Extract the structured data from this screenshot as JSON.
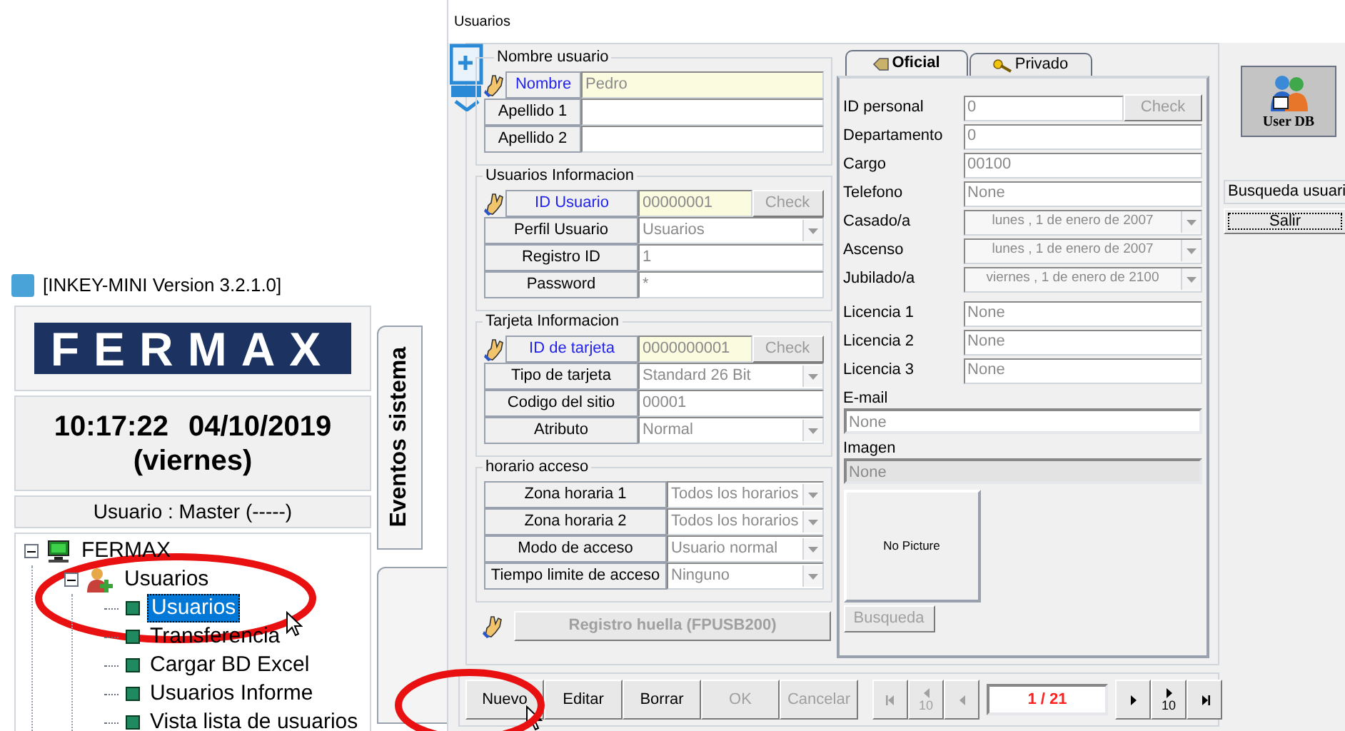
{
  "main_window": {
    "title": "[INKEY-MINI Version 3.2.1.0]",
    "logo": "FERMAX",
    "clock": {
      "time": "10:17:22",
      "date": "04/10/2019",
      "weekday": "(viernes)"
    },
    "user_label": "Usuario : Master (-----)",
    "side_tab": "Eventos sistema",
    "tree": [
      {
        "label": "FERMAX",
        "kind": "computer",
        "expanded": true,
        "selected": false,
        "children": [
          {
            "label": "Usuarios",
            "kind": "users",
            "expanded": true,
            "selected": false,
            "children": [
              {
                "label": "Usuarios",
                "kind": "leaf",
                "selected": true
              },
              {
                "label": "Transferencia",
                "kind": "leaf",
                "selected": false
              },
              {
                "label": "Cargar BD Excel",
                "kind": "leaf",
                "selected": false
              },
              {
                "label": "Usuarios Informe",
                "kind": "leaf",
                "selected": false
              },
              {
                "label": "Vista lista de usuarios",
                "kind": "leaf",
                "selected": false
              }
            ]
          }
        ]
      }
    ]
  },
  "dialog": {
    "title": "Usuarios",
    "groups": [
      {
        "title": "Nombre usuario",
        "rows": [
          {
            "label": "Nombre",
            "kind": "text",
            "value": "Pedro",
            "primary": true
          },
          {
            "label": "Apellido 1",
            "kind": "text",
            "primary": false
          },
          {
            "label": "Apellido 2",
            "kind": "text",
            "primary": false
          }
        ]
      },
      {
        "title": "Usuarios Informacion",
        "rows": [
          {
            "label": "ID Usuario",
            "kind": "text",
            "value": "00000001",
            "primary": true,
            "button": "Check"
          },
          {
            "label": "Perfil Usuario",
            "kind": "select",
            "value": "Usuarios",
            "primary": false
          },
          {
            "label": "Registro ID",
            "kind": "text",
            "value": "1",
            "primary": false
          },
          {
            "label": "Password",
            "kind": "text",
            "value": "*",
            "primary": false
          }
        ]
      },
      {
        "title": "Tarjeta Informacion",
        "rows": [
          {
            "label": "ID de tarjeta",
            "kind": "text",
            "value": "0000000001",
            "primary": true,
            "button": "Check"
          },
          {
            "label": "Tipo de tarjeta",
            "kind": "select",
            "value": "Standard 26 Bit",
            "primary": false
          },
          {
            "label": "Codigo del sitio",
            "kind": "text",
            "value": "00001",
            "primary": false
          },
          {
            "label": "Atributo",
            "kind": "select",
            "value": "Normal",
            "primary": false
          }
        ]
      },
      {
        "title": "horario acceso",
        "rows": [
          {
            "label": "Zona horaria 1",
            "kind": "select",
            "value": "Todos los horarios",
            "primary": false
          },
          {
            "label": "Zona horaria 2",
            "kind": "select",
            "value": "Todos los horarios",
            "primary": false
          },
          {
            "label": "Modo de acceso",
            "kind": "select",
            "value": "Usuario normal",
            "primary": false
          },
          {
            "label": "Tiempo limite de acceso",
            "kind": "select",
            "value": "Ninguno",
            "primary": false
          }
        ]
      }
    ],
    "fingerprint_button": {
      "label": "Registro huella (FPUSB200)",
      "disabled": true
    },
    "tabs": [
      {
        "label": "Oficial",
        "selected": true
      },
      {
        "label": "Privado",
        "selected": false
      }
    ],
    "tab_fields": [
      {
        "label": "ID personal",
        "kind": "text",
        "value": "0",
        "button": "Check",
        "readonly": false
      },
      {
        "label": "Departamento",
        "kind": "text",
        "value": "0",
        "readonly": false
      },
      {
        "label": "Cargo",
        "kind": "text",
        "value": "00100",
        "readonly": false
      },
      {
        "label": "Telefono",
        "kind": "text",
        "value": "None",
        "readonly": false
      },
      {
        "label": "Casado/a",
        "kind": "date",
        "value": "lunes , 1 de enero de 2007",
        "readonly": false
      },
      {
        "label": "Ascenso",
        "kind": "date",
        "value": "lunes , 1 de enero de 2007",
        "readonly": false
      },
      {
        "label": "Jubilado/a",
        "kind": "date",
        "value": "viernes , 1 de enero de 2100",
        "readonly": false
      },
      {
        "label": "Licencia 1",
        "kind": "text",
        "value": "None",
        "readonly": false
      },
      {
        "label": "Licencia 2",
        "kind": "text",
        "value": "None",
        "readonly": false
      },
      {
        "label": "Licencia 3",
        "kind": "text",
        "value": "None",
        "readonly": false
      },
      {
        "label": "E-mail",
        "kind": "stacked",
        "value": "None",
        "readonly": false
      },
      {
        "label": "Imagen",
        "kind": "stacked",
        "value": "None",
        "readonly": true
      }
    ],
    "photo": {
      "text": "No Picture"
    },
    "search_button": {
      "label": "Busqueda",
      "disabled": true
    },
    "user_db_button": "User DB",
    "search_label": "Busqueda usuari",
    "exit_button": "Salir",
    "toolbar": {
      "buttons": [
        {
          "label": "Nuevo",
          "disabled": false
        },
        {
          "label": "Editar",
          "disabled": false
        },
        {
          "label": "Borrar",
          "disabled": false
        },
        {
          "label": "OK",
          "disabled": true
        },
        {
          "label": "Cancelar",
          "disabled": true
        }
      ],
      "nav": [
        {
          "kind": "first",
          "disabled": true
        },
        {
          "kind": "prev10",
          "label": "10",
          "disabled": true
        },
        {
          "kind": "prev",
          "disabled": true
        },
        {
          "kind": "page",
          "label": "1 / 21",
          "disabled": false
        },
        {
          "kind": "next",
          "disabled": false
        },
        {
          "kind": "next10",
          "label": "10",
          "disabled": false
        },
        {
          "kind": "last",
          "disabled": false
        }
      ]
    }
  }
}
